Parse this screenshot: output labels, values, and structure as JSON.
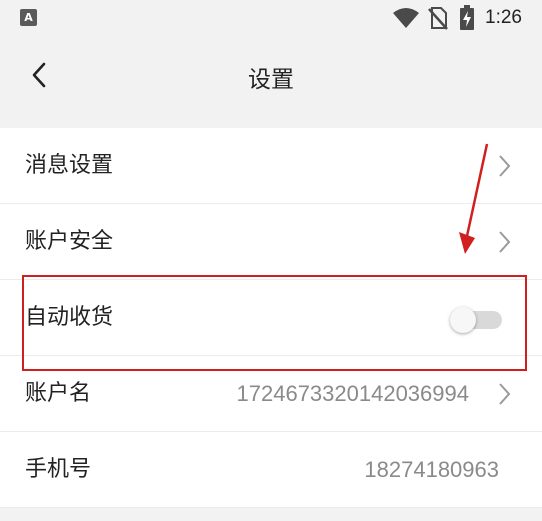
{
  "status_bar": {
    "app_icon_letter": "A",
    "time": "1:26",
    "icons": [
      "wifi-icon",
      "no-sim-icon",
      "battery-charging-icon"
    ]
  },
  "header": {
    "title": "设置",
    "back_icon": "chevron-left-icon"
  },
  "settings": {
    "message_settings": {
      "label": "消息设置"
    },
    "account_security": {
      "label": "账户安全"
    },
    "auto_receive": {
      "label": "自动收货",
      "enabled": false
    },
    "account_name": {
      "label": "账户名",
      "value": "17246733201420369​94"
    },
    "phone": {
      "label": "手机号",
      "value": "18274180963"
    }
  },
  "annotation": {
    "color": "#d11f1f",
    "type": "highlight-box-with-arrow"
  },
  "colors": {
    "background": "#f2f2f2",
    "row_background": "#ffffff",
    "value_text": "#8a8a8a",
    "toggle_off_track": "#d9d9d9"
  }
}
